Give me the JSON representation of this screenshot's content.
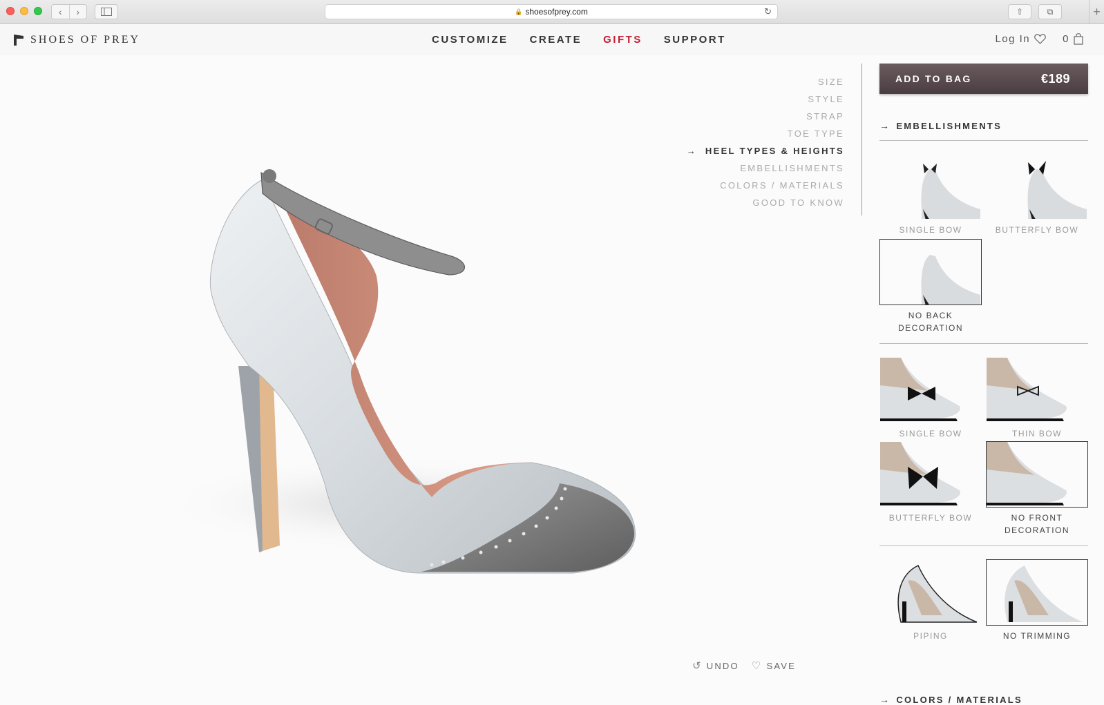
{
  "browser": {
    "url": "shoesofprey.com",
    "icons": [
      "back-icon",
      "forward-icon",
      "sidebar-icon",
      "lock-icon",
      "reload-icon",
      "share-icon",
      "tabs-icon",
      "new-tab-icon"
    ]
  },
  "header": {
    "brand": "SHOES OF PREY",
    "nav": [
      {
        "label": "CUSTOMIZE",
        "highlight": false
      },
      {
        "label": "CREATE",
        "highlight": false
      },
      {
        "label": "GIFTS",
        "highlight": true
      },
      {
        "label": "SUPPORT",
        "highlight": false
      }
    ],
    "login": "Log In",
    "bag_count": "0",
    "accent": "#c21f32"
  },
  "steps": [
    {
      "label": "SIZE",
      "active": false
    },
    {
      "label": "STYLE",
      "active": false
    },
    {
      "label": "STRAP",
      "active": false
    },
    {
      "label": "TOE TYPE",
      "active": false
    },
    {
      "label": "HEEL TYPES & HEIGHTS",
      "active": true
    },
    {
      "label": "EMBELLISHMENTS",
      "active": false
    },
    {
      "label": "COLORS / MATERIALS",
      "active": false
    },
    {
      "label": "GOOD TO KNOW",
      "active": false
    }
  ],
  "actions": {
    "undo": "UNDO",
    "save": "SAVE"
  },
  "panel": {
    "add_to_bag": "ADD TO BAG",
    "price": "€189",
    "section_title": "EMBELLISHMENTS",
    "back_options": [
      {
        "label": "SINGLE BOW",
        "selected": false
      },
      {
        "label": "BUTTERFLY BOW",
        "selected": false
      },
      {
        "label": "NO BACK DECORATION",
        "selected": true
      }
    ],
    "front_options": [
      {
        "label": "SINGLE BOW",
        "selected": false
      },
      {
        "label": "THIN BOW",
        "selected": false
      },
      {
        "label": "BUTTERFLY BOW",
        "selected": false
      },
      {
        "label": "NO FRONT DECORATION",
        "selected": true
      }
    ],
    "trim_options": [
      {
        "label": "PIPING",
        "selected": false
      },
      {
        "label": "NO TRIMMING",
        "selected": true
      }
    ],
    "next_section": "COLORS / MATERIALS"
  }
}
